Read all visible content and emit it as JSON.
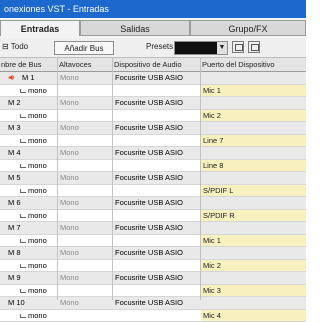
{
  "window": {
    "title": "onexiones VST - Entradas"
  },
  "tabs": [
    {
      "label": "Entradas"
    },
    {
      "label": "Salidas"
    },
    {
      "label": "Grupo/FX"
    }
  ],
  "toolbar": {
    "collapse_all_label": "⊟ Todo",
    "add_bus_label": "Añadir Bus",
    "presets_label": "Presets",
    "presets_value": ""
  },
  "table": {
    "headers": [
      "nbre de Bus",
      "Altavoces",
      "Dispositivo de Audio",
      "Puerto del Dispositivo"
    ],
    "buses": [
      {
        "name": "M 1",
        "speakers": "Mono",
        "device": "Focusrite USB ASIO",
        "channel": "mono",
        "port": "Mic 1"
      },
      {
        "name": "M 2",
        "speakers": "Mono",
        "device": "Focusrite USB ASIO",
        "channel": "mono",
        "port": "Mic 2"
      },
      {
        "name": "M 3",
        "speakers": "Mono",
        "device": "Focusrite USB ASIO",
        "channel": "mono",
        "port": "Line 7"
      },
      {
        "name": "M 4",
        "speakers": "Mono",
        "device": "Focusrite USB ASIO",
        "channel": "mono",
        "port": "Line 8"
      },
      {
        "name": "M 5",
        "speakers": "Mono",
        "device": "Focusrite USB ASIO",
        "channel": "mono",
        "port": "S/PDIF L"
      },
      {
        "name": "M 6",
        "speakers": "Mono",
        "device": "Focusrite USB ASIO",
        "channel": "mono",
        "port": "S/PDIF R"
      },
      {
        "name": "M 7",
        "speakers": "Mono",
        "device": "Focusrite USB ASIO",
        "channel": "mono",
        "port": "Mic 1"
      },
      {
        "name": "M 8",
        "speakers": "Mono",
        "device": "Focusrite USB ASIO",
        "channel": "mono",
        "port": "Mic 2"
      },
      {
        "name": "M 9",
        "speakers": "Mono",
        "device": "Focusrite USB ASIO",
        "channel": "mono",
        "port": "Mic 3"
      },
      {
        "name": "M 10",
        "speakers": "Mono",
        "device": "Focusrite USB ASIO",
        "channel": "mono",
        "port": "Mic 4"
      }
    ]
  },
  "colors": {
    "titlebar": "#1c68cc",
    "port_cell": "#f7f0bf",
    "speaker_icon": "#e04020"
  }
}
